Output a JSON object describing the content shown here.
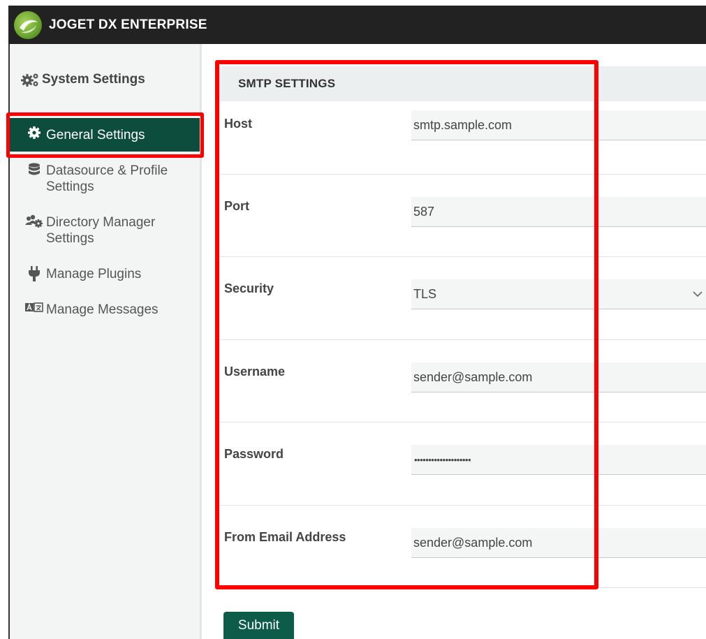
{
  "app": {
    "title": "JOGET DX ENTERPRISE"
  },
  "sidebar": {
    "heading": "System Settings",
    "items": [
      {
        "label": "General Settings",
        "icon": "gear-icon",
        "active": true
      },
      {
        "label": "Datasource & Profile",
        "label2": "Settings",
        "icon": "database-icon"
      },
      {
        "label": "Directory Manager",
        "label2": "Settings",
        "icon": "users-gear-icon"
      },
      {
        "label": "Manage Plugins",
        "icon": "plug-icon"
      },
      {
        "label": "Manage Messages",
        "icon": "language-icon"
      }
    ]
  },
  "smtp": {
    "heading": "SMTP SETTINGS",
    "fields": [
      {
        "label": "Host",
        "value": "smtp.sample.com"
      },
      {
        "label": "Port",
        "value": "587"
      },
      {
        "label": "Security",
        "value": "TLS",
        "type": "select"
      },
      {
        "label": "Username",
        "value": "sender@sample.com"
      },
      {
        "label": "Password",
        "value": "••••••••••••••••••••",
        "type": "password"
      },
      {
        "label": "From Email Address",
        "value": "sender@sample.com"
      }
    ],
    "submit_label": "Submit"
  },
  "colors": {
    "topbar": "#222222",
    "active_nav": "#0d4d3e",
    "submit": "#0d5c4a",
    "highlight": "#ff0000"
  }
}
